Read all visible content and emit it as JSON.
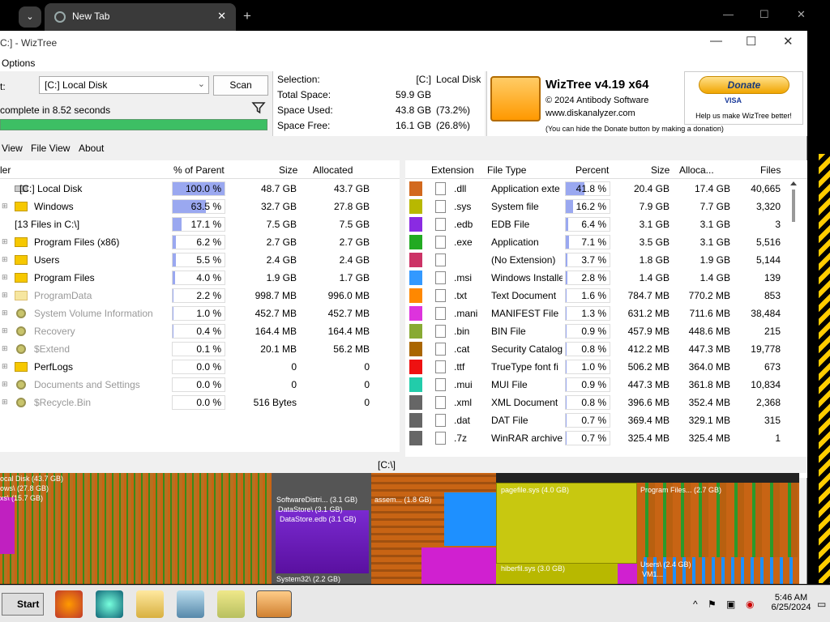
{
  "browser": {
    "tab_title": "New Tab",
    "new_tab": "+",
    "minimize": "—",
    "maximize": "☐",
    "close": "✕",
    "tab_close": "✕",
    "dropdown": "⌄"
  },
  "window": {
    "title": "C:] - WizTree",
    "minimize": "—",
    "maximize": "☐",
    "close": "✕"
  },
  "menu": {
    "options": "Options"
  },
  "controls": {
    "select_label": "t:",
    "drive": "[C:] Local Disk",
    "scan": "Scan",
    "status": "complete in 8.52 seconds",
    "progress": 1.0
  },
  "stats": {
    "selection_label": "Selection:",
    "selection_drive": "[C:]",
    "selection_name": "Local Disk",
    "total_label": "Total Space:",
    "total_value": "59.9 GB",
    "used_label": "Space Used:",
    "used_value": "43.8 GB",
    "used_pct": "(73.2%)",
    "free_label": "Space Free:",
    "free_value": "16.1 GB",
    "free_pct": "(26.8%)"
  },
  "brand": {
    "name": "WizTree v4.19 x64",
    "copyright": "© 2024 Antibody Software",
    "url": "www.diskanalyzer.com",
    "hint": "(You can hide the Donate button by making a donation)",
    "donate": "Donate",
    "cards": "VISA",
    "donate_text": "Help us make WizTree better!"
  },
  "tabs": {
    "tree": "View",
    "file": "File View",
    "about": "About"
  },
  "left_headers": {
    "folder": "ler",
    "pct": "% of Parent",
    "size": "Size",
    "allocated": "Allocated"
  },
  "left_rows": [
    {
      "name": "[C:] Local Disk",
      "pct": "100.0 %",
      "pctv": 100,
      "size": "48.7 GB",
      "alloc": "43.7 GB",
      "kind": "drive"
    },
    {
      "name": "Windows",
      "pct": "63.5 %",
      "pctv": 63.5,
      "size": "32.7 GB",
      "alloc": "27.8 GB",
      "kind": "folder"
    },
    {
      "name": "[13 Files in C:\\]",
      "pct": "17.1 %",
      "pctv": 17.1,
      "size": "7.5 GB",
      "alloc": "7.5 GB",
      "kind": "files"
    },
    {
      "name": "Program Files (x86)",
      "pct": "6.2 %",
      "pctv": 6.2,
      "size": "2.7 GB",
      "alloc": "2.7 GB",
      "kind": "folder"
    },
    {
      "name": "Users",
      "pct": "5.5 %",
      "pctv": 5.5,
      "size": "2.4 GB",
      "alloc": "2.4 GB",
      "kind": "folder"
    },
    {
      "name": "Program Files",
      "pct": "4.0 %",
      "pctv": 4.0,
      "size": "1.9 GB",
      "alloc": "1.7 GB",
      "kind": "folder"
    },
    {
      "name": "ProgramData",
      "pct": "2.2 %",
      "pctv": 2.2,
      "size": "998.7 MB",
      "alloc": "996.0 MB",
      "kind": "hidden"
    },
    {
      "name": "System Volume Information",
      "pct": "1.0 %",
      "pctv": 1.0,
      "size": "452.7 MB",
      "alloc": "452.7 MB",
      "kind": "system"
    },
    {
      "name": "Recovery",
      "pct": "0.4 %",
      "pctv": 0.4,
      "size": "164.4 MB",
      "alloc": "164.4 MB",
      "kind": "system"
    },
    {
      "name": "$Extend",
      "pct": "0.1 %",
      "pctv": 0.1,
      "size": "20.1 MB",
      "alloc": "56.2 MB",
      "kind": "system"
    },
    {
      "name": "PerfLogs",
      "pct": "0.0 %",
      "pctv": 0,
      "size": "0",
      "alloc": "0",
      "kind": "folder"
    },
    {
      "name": "Documents and Settings",
      "pct": "0.0 %",
      "pctv": 0,
      "size": "0",
      "alloc": "0",
      "kind": "system"
    },
    {
      "name": "$Recycle.Bin",
      "pct": "0.0 %",
      "pctv": 0,
      "size": "516 Bytes",
      "alloc": "0",
      "kind": "system"
    }
  ],
  "right_headers": {
    "ext": "Extension",
    "type": "File Type",
    "pct": "Percent",
    "size": "Size",
    "alloc": "Alloca...",
    "files": "Files"
  },
  "right_rows": [
    {
      "ext": ".dll",
      "type": "Application exte",
      "pct": "41.8 %",
      "pctv": 41.8,
      "size": "20.4 GB",
      "alloc": "17.4 GB",
      "files": "40,665",
      "color": "#d2691e"
    },
    {
      "ext": ".sys",
      "type": "System file",
      "pct": "16.2 %",
      "pctv": 16.2,
      "size": "7.9 GB",
      "alloc": "7.7 GB",
      "files": "3,320",
      "color": "#b8b800"
    },
    {
      "ext": ".edb",
      "type": "EDB File",
      "pct": "6.4 %",
      "pctv": 6.4,
      "size": "3.1 GB",
      "alloc": "3.1 GB",
      "files": "3",
      "color": "#8a2be2"
    },
    {
      "ext": ".exe",
      "type": "Application",
      "pct": "7.1 %",
      "pctv": 7.1,
      "size": "3.5 GB",
      "alloc": "3.1 GB",
      "files": "5,516",
      "color": "#22aa22"
    },
    {
      "ext": "",
      "type": "(No Extension)",
      "pct": "3.7 %",
      "pctv": 3.7,
      "size": "1.8 GB",
      "alloc": "1.9 GB",
      "files": "5,144",
      "color": "#cc3366"
    },
    {
      "ext": ".msi",
      "type": "Windows Installe",
      "pct": "2.8 %",
      "pctv": 2.8,
      "size": "1.4 GB",
      "alloc": "1.4 GB",
      "files": "139",
      "color": "#3399ff"
    },
    {
      "ext": ".txt",
      "type": "Text Document",
      "pct": "1.6 %",
      "pctv": 1.6,
      "size": "784.7 MB",
      "alloc": "770.2 MB",
      "files": "853",
      "color": "#ff8800"
    },
    {
      "ext": ".mani",
      "type": "MANIFEST File",
      "pct": "1.3 %",
      "pctv": 1.3,
      "size": "631.2 MB",
      "alloc": "711.6 MB",
      "files": "38,484",
      "color": "#dd33dd"
    },
    {
      "ext": ".bin",
      "type": "BIN File",
      "pct": "0.9 %",
      "pctv": 0.9,
      "size": "457.9 MB",
      "alloc": "448.6 MB",
      "files": "215",
      "color": "#88aa33"
    },
    {
      "ext": ".cat",
      "type": "Security Catalog",
      "pct": "0.8 %",
      "pctv": 0.8,
      "size": "412.2 MB",
      "alloc": "447.3 MB",
      "files": "19,778",
      "color": "#aa6600"
    },
    {
      "ext": ".ttf",
      "type": "TrueType font fi",
      "pct": "1.0 %",
      "pctv": 1.0,
      "size": "506.2 MB",
      "alloc": "364.0 MB",
      "files": "673",
      "color": "#ee1111"
    },
    {
      "ext": ".mui",
      "type": "MUI File",
      "pct": "0.9 %",
      "pctv": 0.9,
      "size": "447.3 MB",
      "alloc": "361.8 MB",
      "files": "10,834",
      "color": "#22ccaa"
    },
    {
      "ext": ".xml",
      "type": "XML Document",
      "pct": "0.8 %",
      "pctv": 0.8,
      "size": "396.6 MB",
      "alloc": "352.4 MB",
      "files": "2,368",
      "color": "#666666"
    },
    {
      "ext": ".dat",
      "type": "DAT File",
      "pct": "0.7 %",
      "pctv": 0.7,
      "size": "369.4 MB",
      "alloc": "329.1 MB",
      "files": "315",
      "color": "#666666"
    },
    {
      "ext": ".7z",
      "type": "WinRAR archive",
      "pct": "0.7 %",
      "pctv": 0.7,
      "size": "325.4 MB",
      "alloc": "325.4 MB",
      "files": "1",
      "color": "#666666"
    }
  ],
  "path": "[C:\\]",
  "treemap_labels": {
    "a": "ocal Disk (43.7 GB)",
    "b": "ows\\ (27.8 GB)",
    "c": "xs\\ (15.7 GB)",
    "d": "SoftwareDistri... (3.1 GB)",
    "e": "DataStore\\ (3.1 GB)",
    "f": "DataStore.edb (3.1 GB)",
    "g": "assem... (1.8 GB)",
    "h": "pagefile.sys (4.0 GB)",
    "i": "Program Files... (2.7 GB)",
    "j": "System32\\ (2.2 GB)",
    "k": "hiberfil.sys (3.0 GB)",
    "l": "Users\\ (2.4 GB)",
    "m": "VM1..."
  },
  "taskbar": {
    "start": "Start",
    "time": "5:46 AM",
    "date": "6/25/2024",
    "tray_arrow": "^"
  }
}
